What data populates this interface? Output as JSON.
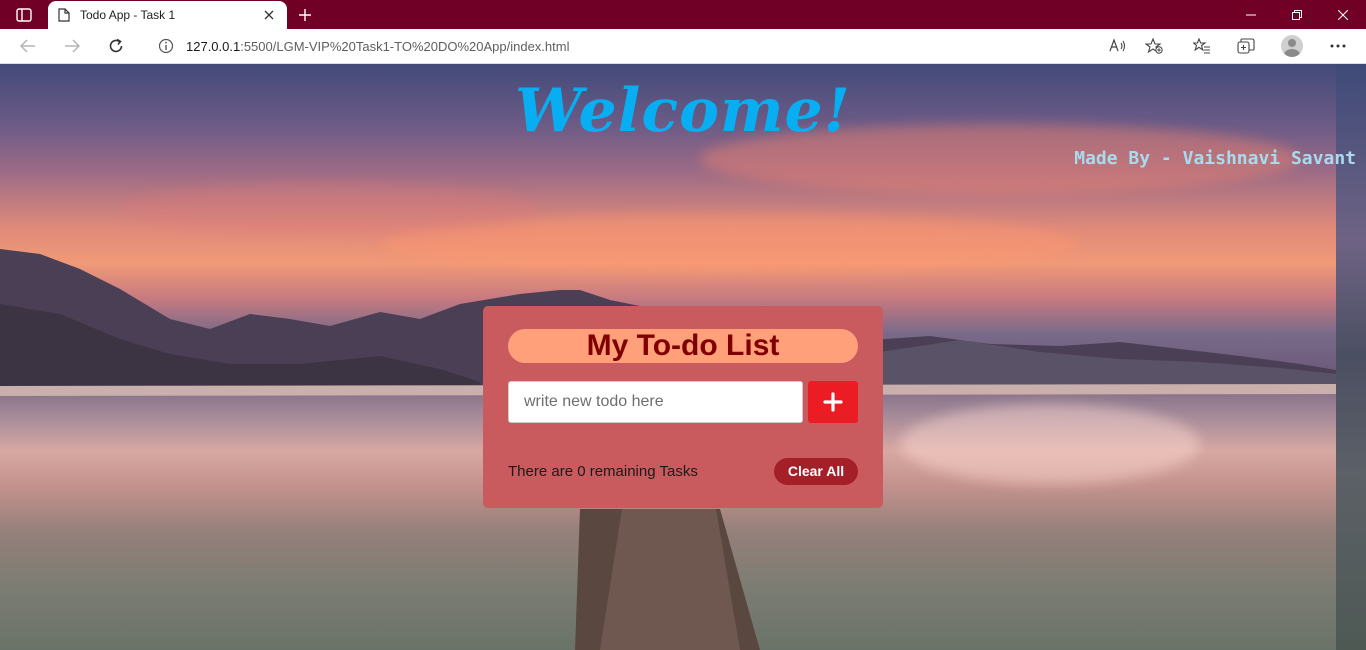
{
  "browser": {
    "tab_title": "Todo App - Task 1",
    "url_host": "127.0.0.1",
    "url_path": ":5500/LGM-VIP%20Task1-TO%20DO%20App/index.html",
    "colors": {
      "titlebar": "#700026",
      "toolbar": "#ffffff"
    }
  },
  "page": {
    "welcome": "Welcome!",
    "made_by": "Made By - Vaishnavi Savant",
    "colors": {
      "welcome": "#08aef2",
      "made_by": "#a9dbf0"
    }
  },
  "todo": {
    "title": "My To-do List",
    "input_placeholder": "write new todo here",
    "add_icon": "plus-icon",
    "remaining_text": "There are 0 remaining Tasks",
    "clear_label": "Clear All",
    "colors": {
      "card": "#c95b5e",
      "title_bg": "#ffa07a",
      "title_text": "#800000",
      "add_button": "#ec1c24",
      "clear_button": "#a51f28"
    }
  }
}
